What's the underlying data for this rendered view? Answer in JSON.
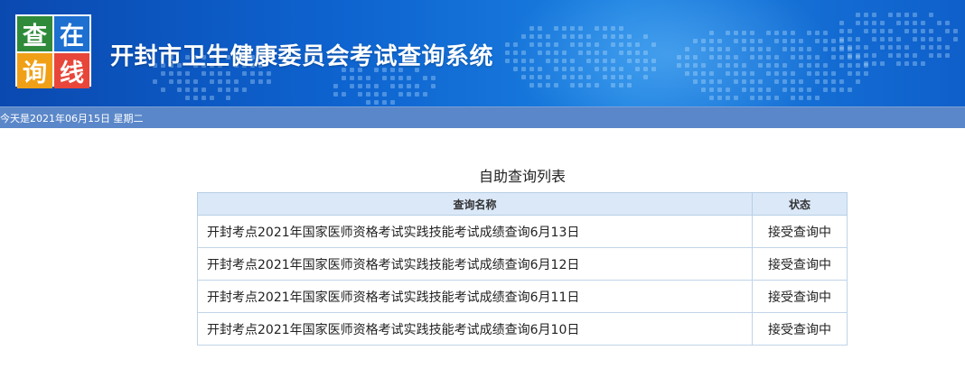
{
  "logo": {
    "chars": [
      "查",
      "在",
      "询",
      "线"
    ]
  },
  "site": {
    "title": "开封市卫生健康委员会考试查询系统"
  },
  "datebar": {
    "text": "今天是2021年06月15日  星期二"
  },
  "list": {
    "title": "自助查询列表",
    "headers": {
      "name": "查询名称",
      "status": "状态"
    },
    "rows": [
      {
        "name": "开封考点2021年国家医师资格考试实践技能考试成绩查询6月13日",
        "status": "接受查询中"
      },
      {
        "name": "开封考点2021年国家医师资格考试实践技能考试成绩查询6月12日",
        "status": "接受查询中"
      },
      {
        "name": "开封考点2021年国家医师资格考试实践技能考试成绩查询6月11日",
        "status": "接受查询中"
      },
      {
        "name": "开封考点2021年国家医师资格考试实践技能考试成绩查询6月10日",
        "status": "接受查询中"
      }
    ]
  },
  "colors": {
    "banner": "#0e63cf",
    "datebar": "#5a87c9",
    "header_row": "#dbe8f8"
  }
}
